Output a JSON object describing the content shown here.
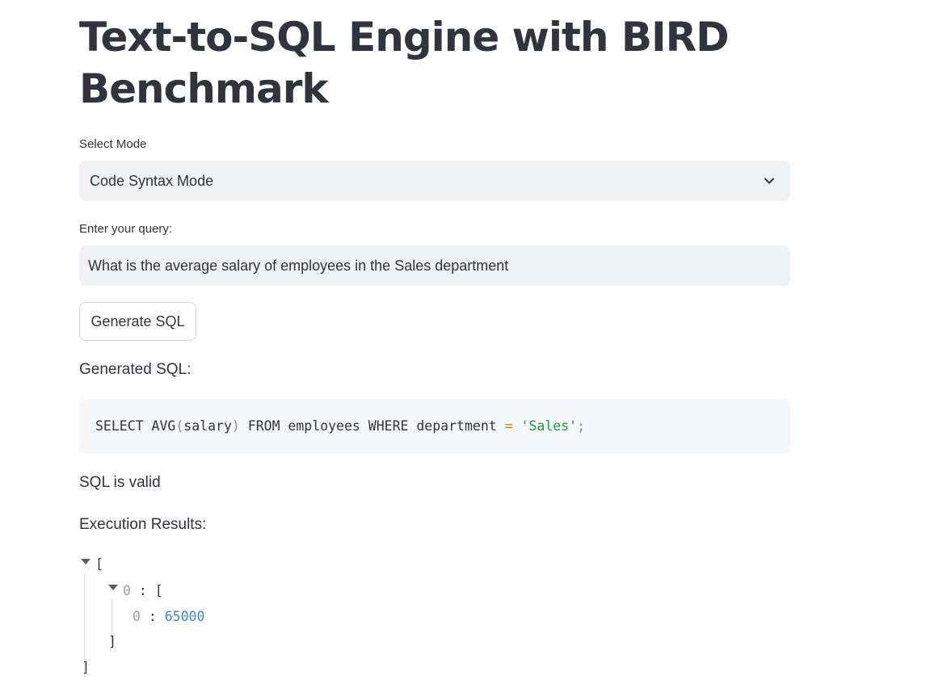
{
  "page": {
    "title": "Text-to-SQL Engine with BIRD Benchmark"
  },
  "mode_select": {
    "label": "Select Mode",
    "value": "Code Syntax Mode",
    "icon": "chevron-down-icon"
  },
  "query": {
    "label": "Enter your query:",
    "value": "What is the average salary of employees in the Sales department"
  },
  "generate_button": {
    "label": "Generate SQL"
  },
  "generated": {
    "heading": "Generated SQL:",
    "tokens": {
      "t1": "SELECT AVG",
      "p1": "(",
      "t2": "salary",
      "p2": ")",
      "t3": " FROM employees WHERE department ",
      "op": "=",
      "sp": " ",
      "str": "'Sales'",
      "semi": ";"
    },
    "status": "SQL is valid"
  },
  "results": {
    "heading": "Execution Results:",
    "open_bracket": "[",
    "inner_key": "0",
    "colon": " : ",
    "inner_open": "[",
    "value_key": "0",
    "value": "65000",
    "inner_close": "]",
    "close_bracket": "]"
  },
  "colors": {
    "text": "#31333f",
    "input_bg": "#f0f2f6",
    "code_bg": "#f6f7f9",
    "sql_operator": "#d4781e",
    "sql_string": "#1e9a3b",
    "json_number": "#3d84c8",
    "json_key": "#9aa0ad"
  }
}
